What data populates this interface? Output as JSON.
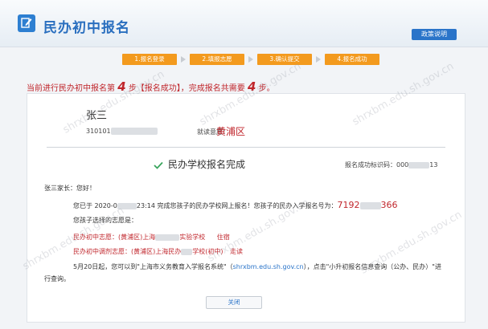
{
  "header": {
    "title": "民办初中报名",
    "policy_button": "政策说明"
  },
  "steps": [
    {
      "label": "1.报名登录"
    },
    {
      "label": "2.填报志愿"
    },
    {
      "label": "3.确认提交"
    },
    {
      "label": "4.报名成功"
    }
  ],
  "progress": {
    "prefix": "当前进行民办初中报名第",
    "current_step": "4",
    "middle": "步【报名成功】，完成报名共需要",
    "total_steps": "4",
    "suffix": "步。"
  },
  "student": {
    "name": "张三",
    "id_prefix": "310101",
    "district_label": "就读意愿：",
    "district": "黄浦区"
  },
  "result": {
    "title": "民办学校报名完成",
    "code_label": "报名成功标识码：",
    "code_prefix": "000",
    "code_suffix": "13"
  },
  "letter": {
    "greeting": "张三家长：您好！",
    "line1_prefix": "您已于 2020-0",
    "line1_time": "23:14 完成您孩子的民办学校网上报名！您孩子的民办入学报名号为：",
    "app_no_prefix": "7192",
    "app_no_suffix": "366",
    "choices_intro": "您孩子选择的志愿是：",
    "choice1_prefix": "民办初中志愿：(黄浦区)上海",
    "choice1_school": "实验学校",
    "choice1_type": "住宿",
    "choice2_prefix": "民办初中调剂志愿：(黄浦区)上海民办",
    "choice2_school": "学校(初中)",
    "choice2_type": "走读",
    "notice_prefix": "5月20日起，您可以到\"上海市义务教育入学报名系统\"（",
    "notice_url": "shrxbm.edu.sh.gov.cn",
    "notice_mid": "），点击\"小升初报名信息查询（公办、民办）\"进",
    "notice_end": "行查询。"
  },
  "close_button": "关闭",
  "watermark_text": "shrxbm.edu.sh.gov.cn",
  "colors": {
    "accent": "#2a74c9",
    "step": "#f39a1e",
    "alert": "#c0262c",
    "success": "#3aa55d"
  }
}
